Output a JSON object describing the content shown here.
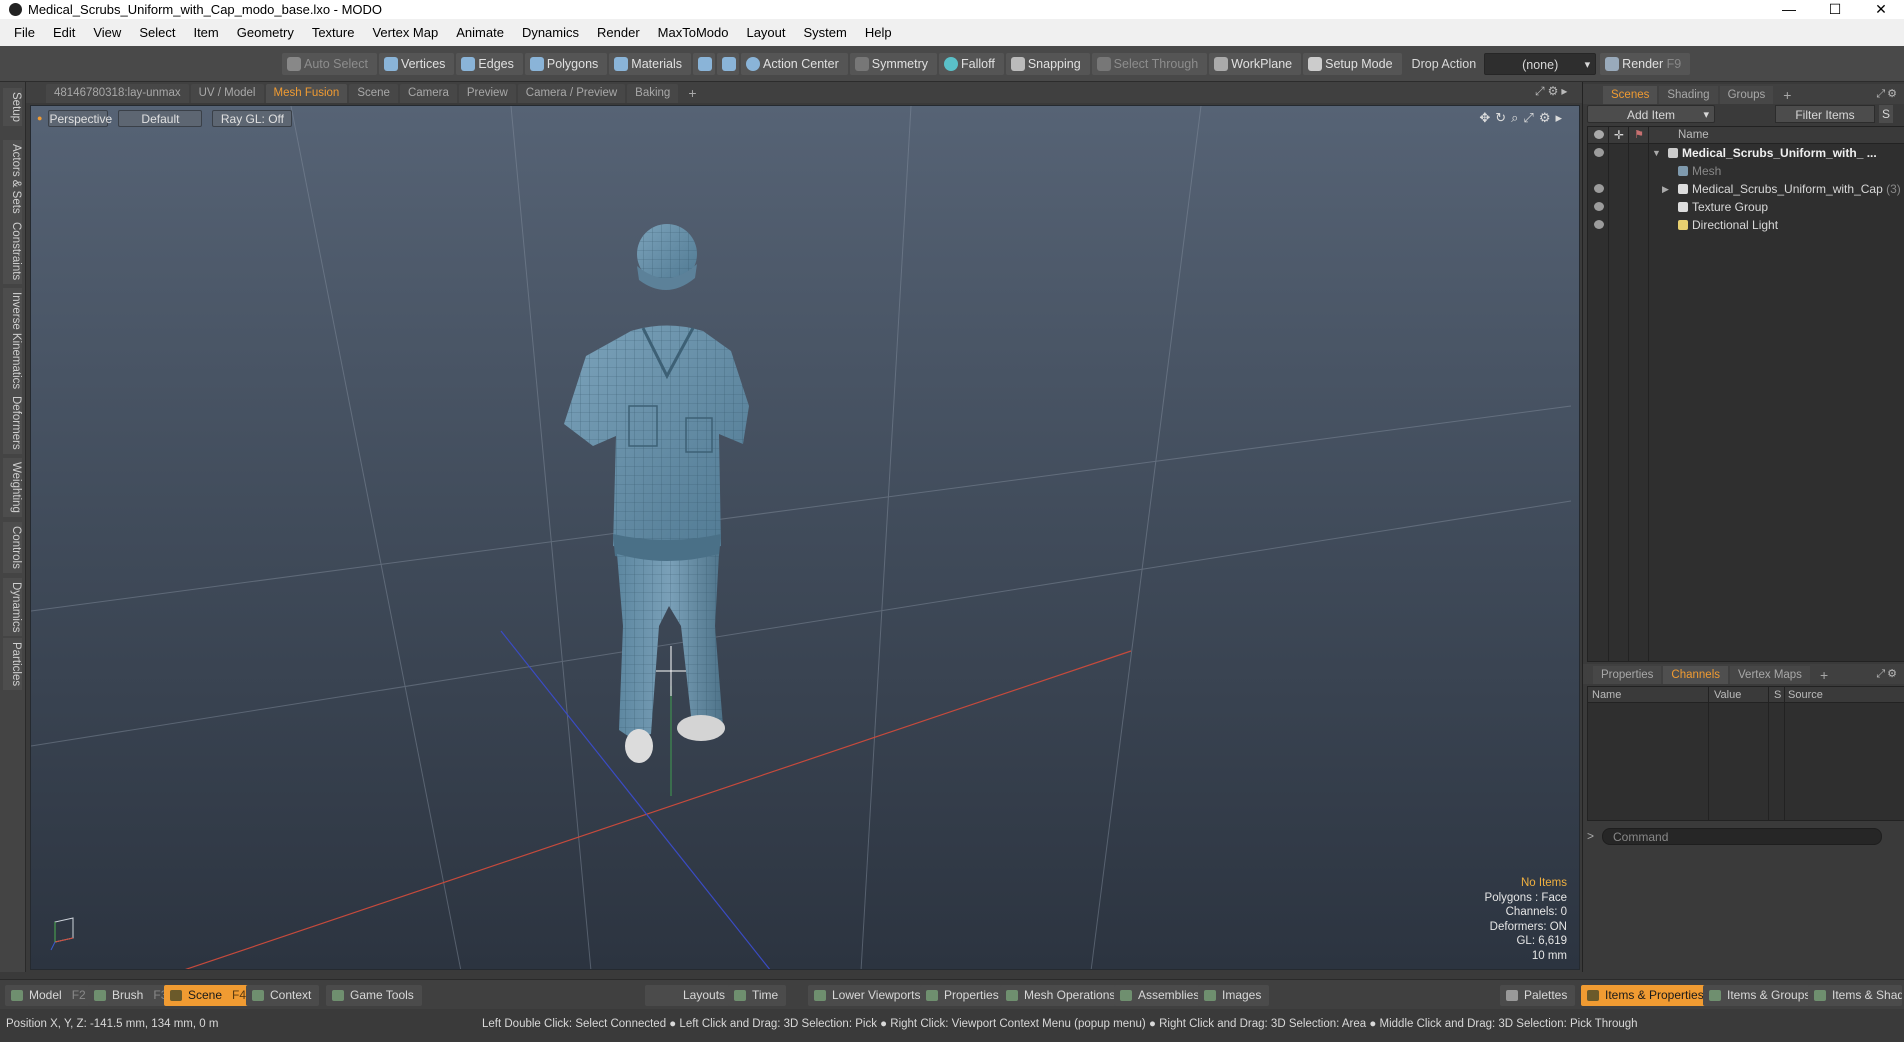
{
  "window": {
    "title": "Medical_Scrubs_Uniform_with_Cap_modo_base.lxo - MODO"
  },
  "menu": [
    "File",
    "Edit",
    "View",
    "Select",
    "Item",
    "Geometry",
    "Texture",
    "Vertex Map",
    "Animate",
    "Dynamics",
    "Render",
    "MaxToModo",
    "Layout",
    "System",
    "Help"
  ],
  "toolbar": {
    "auto_select": "Auto Select",
    "vertices": "Vertices",
    "edges": "Edges",
    "polygons": "Polygons",
    "materials": "Materials",
    "action_center": "Action Center",
    "symmetry": "Symmetry",
    "falloff": "Falloff",
    "snapping": "Snapping",
    "select_through": "Select Through",
    "workplane": "WorkPlane",
    "setup_mode": "Setup Mode",
    "drop_action_label": "Drop Action",
    "drop_action_value": "(none)",
    "render": "Render",
    "render_key": "F9"
  },
  "left_tabs": [
    "Setup",
    "Actors & Sets",
    "Constraints",
    "Inverse Kinematics",
    "Deformers",
    "Weighting",
    "Controls",
    "Dynamics",
    "Particles"
  ],
  "viewport_tabs": [
    "48146780318:lay-unmax",
    "UV / Model",
    "Mesh Fusion",
    "Scene",
    "Camera",
    "Preview",
    "Camera / Preview",
    "Baking",
    "+"
  ],
  "viewport_active_tab": "Mesh Fusion",
  "viewport": {
    "view": "Perspective",
    "shading": "Default",
    "raygl": "Ray GL: Off",
    "hud": [
      "No Items",
      "Polygons : Face",
      "Channels: 0",
      "Deformers: ON",
      "GL: 6,619",
      "10 mm"
    ]
  },
  "right_top_tabs": [
    "Scenes",
    "Shading",
    "Groups",
    "+"
  ],
  "scene_panel": {
    "add_item": "Add Item",
    "filter_items": "Filter Items",
    "filter_s": "S",
    "col_name": "Name",
    "items": [
      {
        "label": "Medical_Scrubs_Uniform_with_ ...",
        "count": ""
      },
      {
        "label": "Mesh",
        "count": ""
      },
      {
        "label": "Medical_Scrubs_Uniform_with_Cap",
        "count": "(3)"
      },
      {
        "label": "Texture Group",
        "count": ""
      },
      {
        "label": "Directional Light",
        "count": ""
      }
    ]
  },
  "right_bottom_tabs": [
    "Properties",
    "Channels",
    "Vertex Maps",
    "+"
  ],
  "channels": {
    "cols": [
      "Name",
      "Value",
      "S",
      "Source"
    ]
  },
  "command": {
    "placeholder": "Command"
  },
  "bottom_buttons": {
    "model": "Model",
    "model_key": "F2",
    "brush": "Brush",
    "brush_key": "F3",
    "scene": "Scene",
    "scene_key": "F4",
    "context": "Context",
    "game_tools": "Game Tools",
    "layouts": "Layouts",
    "time": "Time",
    "lower_viewports": "Lower Viewports",
    "properties": "Properties",
    "mesh_operations": "Mesh Operations",
    "assemblies": "Assemblies",
    "images": "Images",
    "palettes": "Palettes",
    "items_properties": "Items & Properties",
    "items_groups": "Items & Groups",
    "items_shading": "Items & Shading"
  },
  "status": {
    "position": "Position X, Y, Z:   -141.5 mm, 134 mm, 0 m",
    "hint": "Left Double Click: Select Connected ● Left Click and Drag: 3D Selection: Pick ● Right Click: Viewport Context Menu (popup menu) ● Right Click and Drag: 3D Selection: Area ● Middle Click and Drag: 3D Selection: Pick Through"
  },
  "colors": {
    "accent": "#f09b32",
    "viewport_top": "#566375",
    "viewport_bottom": "#2c3440",
    "scrubs": "#6a93ad"
  }
}
